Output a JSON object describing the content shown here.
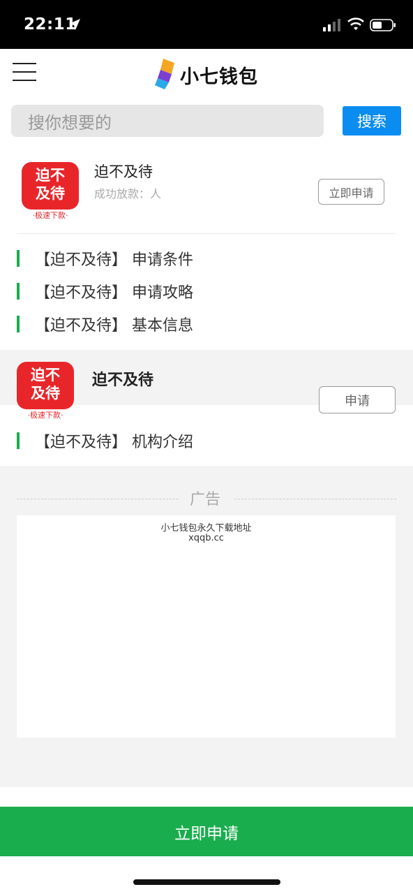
{
  "status_bar": {
    "time": "22:11"
  },
  "header": {
    "logo_text": "小七钱包",
    "search_placeholder": "搜你想要的",
    "search_button": "搜索"
  },
  "app_icon": {
    "line1": "迫不",
    "line2": "及待",
    "sub": "·极速下款·"
  },
  "product1": {
    "title": "迫不及待",
    "subtitle": "成功放款：人",
    "apply_button": "立即申请",
    "links": [
      {
        "label": "【迫不及待】 申请条件"
      },
      {
        "label": "【迫不及待】 申请攻略"
      },
      {
        "label": "【迫不及待】 基本信息"
      }
    ]
  },
  "product2": {
    "title": "迫不及待",
    "apply_button": "申请",
    "links": [
      {
        "label": "【迫不及待】 机构介绍"
      }
    ]
  },
  "ad": {
    "label": "广告",
    "line1": "小七钱包永久下载地址",
    "line2": "xqqb.cc"
  },
  "footer": {
    "apply_button": "立即申请"
  },
  "colors": {
    "green": "#1aad4e",
    "blue": "#0a8cf0",
    "red": "#e8262a"
  }
}
